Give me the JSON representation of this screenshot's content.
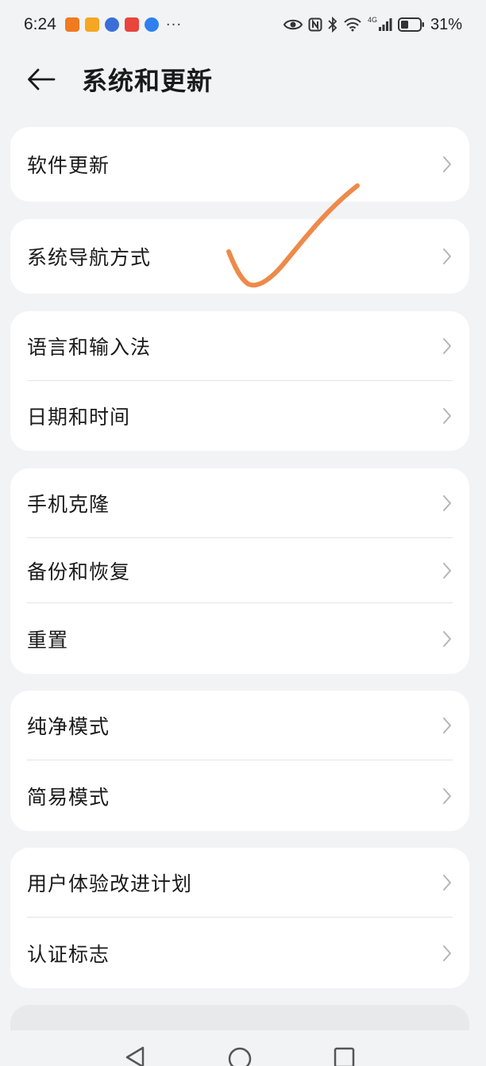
{
  "status_bar": {
    "time": "6:24",
    "battery_percent": "31%",
    "network_label": "4G",
    "app_colors": [
      "#f07a20",
      "#f5a623",
      "#3b6fd8",
      "#e8453c",
      "#2f80ed"
    ],
    "more_glyph": "···"
  },
  "header": {
    "title": "系统和更新",
    "back_icon": "arrow-left-icon"
  },
  "groups": [
    {
      "items": [
        {
          "label": "软件更新"
        }
      ]
    },
    {
      "items": [
        {
          "label": "系统导航方式"
        }
      ]
    },
    {
      "items": [
        {
          "label": "语言和输入法"
        },
        {
          "label": "日期和时间"
        }
      ]
    },
    {
      "items": [
        {
          "label": "手机克隆"
        },
        {
          "label": "备份和恢复"
        },
        {
          "label": "重置"
        }
      ]
    },
    {
      "items": [
        {
          "label": "纯净模式"
        },
        {
          "label": "简易模式"
        }
      ]
    },
    {
      "items": [
        {
          "label": "用户体验改进计划"
        },
        {
          "label": "认证标志"
        }
      ]
    }
  ],
  "annotation": {
    "type": "checkmark",
    "color": "#ee8a4a"
  },
  "colors": {
    "background": "#f1f3f5",
    "card": "#ffffff",
    "chevron": "#b3b5b8"
  }
}
